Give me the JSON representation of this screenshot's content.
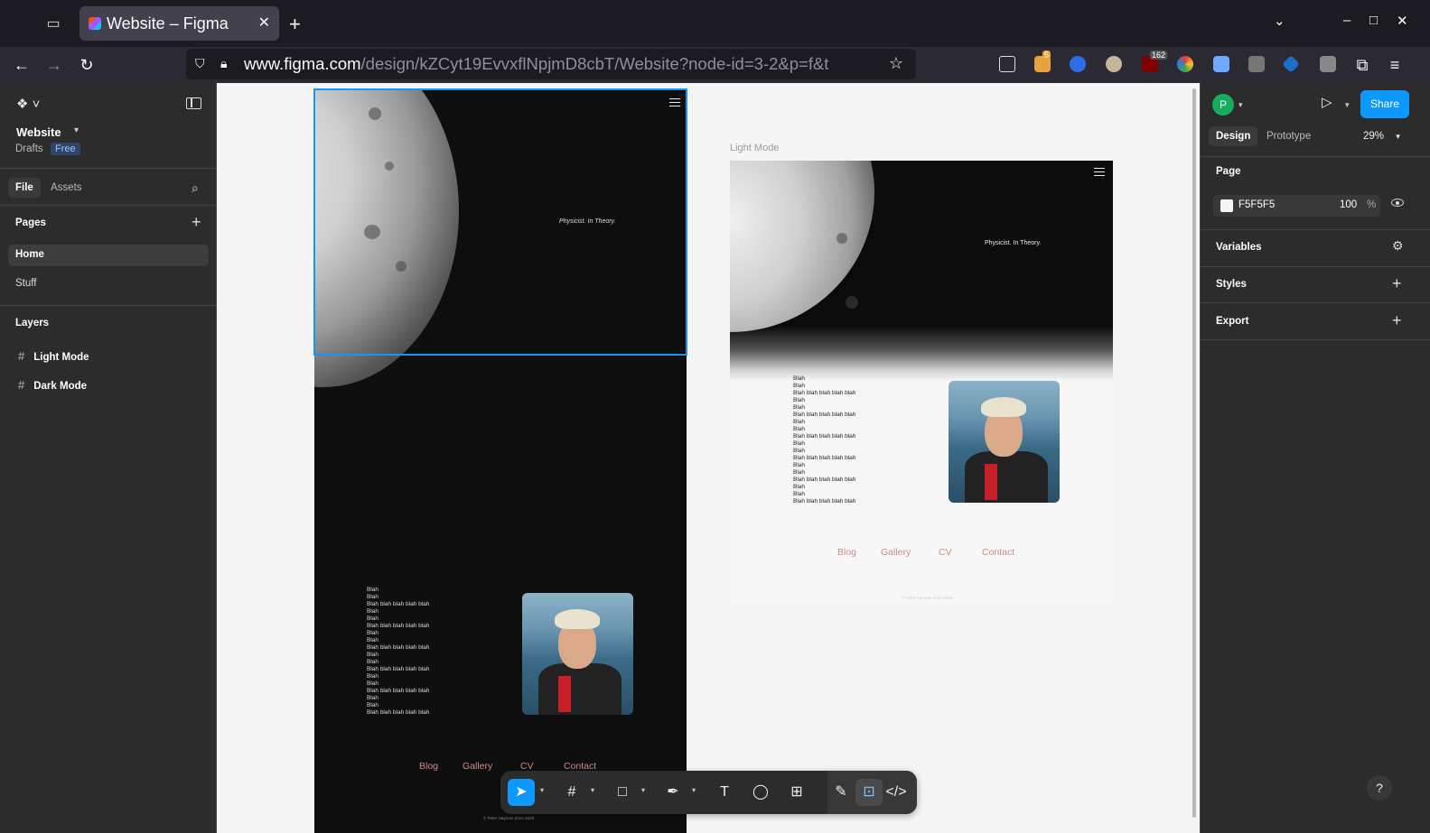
{
  "browser": {
    "tab_title": "Website – Figma",
    "url_host": "www.figma.com",
    "url_path": "/design/kZCyt19EvvxflNpjmD8cbT/Website?node-id=3-2&p=f&t",
    "ext_badge_mail": "5",
    "ext_badge_ublock": "162"
  },
  "file": {
    "name": "Website",
    "location": "Drafts",
    "plan": "Free"
  },
  "left_panel": {
    "tabs": [
      "File",
      "Assets"
    ],
    "pages_title": "Pages",
    "pages": [
      "Home",
      "Stuff"
    ],
    "layers_title": "Layers",
    "layers": [
      "Light Mode",
      "Dark Mode"
    ]
  },
  "canvas": {
    "light_frame_label": "Light Mode",
    "tagline_dark": "Physicist. In Theory.",
    "tagline_light": "Physicist. In Theory.",
    "blah_lines": "Blah\nBlah\nBlah blah blah blah blah\nBlah\nBlah\nBlah blah blah blah blah\nBlah\nBlah\nBlah blah blah blah blah\nBlah\nBlah\nBlah blah blah blah blah\nBlah\nBlah\nBlah blah blah blah blah\nBlah\nBlah\nBlah blah blah blah blah",
    "nav_links": [
      "Blog",
      "Gallery",
      "CV",
      "Contact"
    ],
    "copyright": "© Peter Hayman 2021-2025"
  },
  "right_panel": {
    "avatar_initial": "P",
    "share_label": "Share",
    "tabs": [
      "Design",
      "Prototype"
    ],
    "zoom": "29%",
    "page_section": "Page",
    "fill_hex": "F5F5F5",
    "fill_opacity": "100",
    "fill_unit": "%",
    "sections": [
      "Variables",
      "Styles",
      "Export"
    ],
    "help": "?"
  },
  "colors": {
    "accent": "#0d99ff",
    "panel_bg": "#2c2c2c",
    "canvas_bg": "#f5f5f5",
    "nav_link": "#c98c8c"
  }
}
